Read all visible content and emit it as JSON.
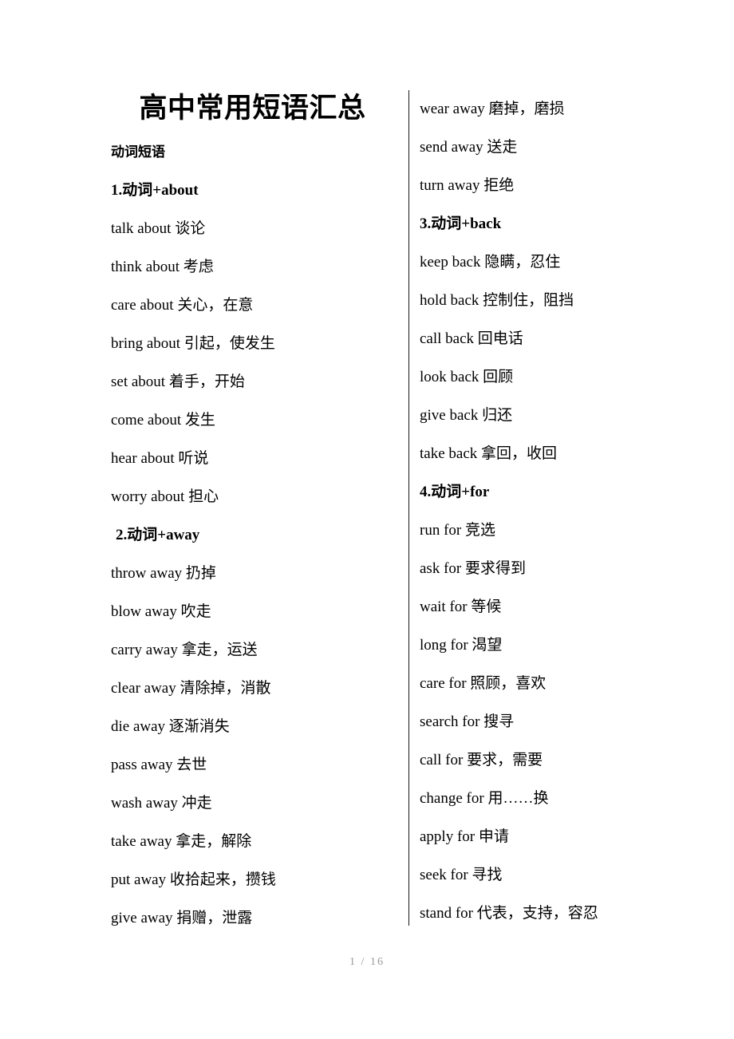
{
  "document": {
    "title": "高中常用短语汇总",
    "section_label": "动词短语",
    "footer": {
      "current_page": "1",
      "separator": "/",
      "total_pages": "16",
      "color": "#9a9a9a"
    },
    "divider_color": "#1a1a1a",
    "text_color": "#000000",
    "background_color": "#ffffff"
  },
  "columns": {
    "left": [
      {
        "type": "title",
        "text": "高中常用短语汇总"
      },
      {
        "type": "heiti",
        "text": "动词短语"
      },
      {
        "type": "subhead",
        "text": "1.动词+about"
      },
      {
        "type": "entry",
        "text": "talk about 谈论"
      },
      {
        "type": "entry",
        "text": "think about 考虑"
      },
      {
        "type": "entry",
        "text": "care about 关心，在意"
      },
      {
        "type": "entry",
        "text": "bring about 引起，使发生"
      },
      {
        "type": "entry",
        "text": "set about 着手，开始"
      },
      {
        "type": "entry",
        "text": "come about 发生"
      },
      {
        "type": "entry",
        "text": "hear about 听说"
      },
      {
        "type": "entry",
        "text": "worry about 担心"
      },
      {
        "type": "subhead",
        "text": "2.动词+away",
        "indent": true
      },
      {
        "type": "entry",
        "text": "throw away 扔掉"
      },
      {
        "type": "entry",
        "text": "blow away 吹走"
      },
      {
        "type": "entry",
        "text": "carry away 拿走，运送"
      },
      {
        "type": "entry",
        "text": "clear away 清除掉，消散"
      },
      {
        "type": "entry",
        "text": "die away 逐渐消失"
      },
      {
        "type": "entry",
        "text": "pass away 去世"
      },
      {
        "type": "entry",
        "text": "wash away 冲走"
      },
      {
        "type": "entry",
        "text": "take away 拿走，解除"
      },
      {
        "type": "entry",
        "text": "put away 收拾起来，攒钱"
      },
      {
        "type": "entry",
        "text": "give away 捐赠，泄露"
      }
    ],
    "right": [
      {
        "type": "entry",
        "text": "wear away 磨掉，磨损"
      },
      {
        "type": "entry",
        "text": "send away 送走"
      },
      {
        "type": "entry",
        "text": "turn away 拒绝"
      },
      {
        "type": "subhead",
        "text": "3.动词+back"
      },
      {
        "type": "entry",
        "text": "keep back 隐瞒，忍住"
      },
      {
        "type": "entry",
        "text": "hold back 控制住，阻挡"
      },
      {
        "type": "entry",
        "text": "call back 回电话"
      },
      {
        "type": "entry",
        "text": "look back 回顾"
      },
      {
        "type": "entry",
        "text": "give back 归还"
      },
      {
        "type": "entry",
        "text": "take back 拿回，收回"
      },
      {
        "type": "subhead",
        "text": "4.动词+for"
      },
      {
        "type": "entry",
        "text": "run for 竞选"
      },
      {
        "type": "entry",
        "text": "ask for 要求得到"
      },
      {
        "type": "entry",
        "text": "wait for 等候"
      },
      {
        "type": "entry",
        "text": "long for 渴望"
      },
      {
        "type": "entry",
        "text": "care for 照顾，喜欢"
      },
      {
        "type": "entry",
        "text": "search for 搜寻"
      },
      {
        "type": "entry",
        "text": "call for 要求，需要"
      },
      {
        "type": "entry",
        "text": "change for 用……换"
      },
      {
        "type": "entry",
        "text": "apply for 申请"
      },
      {
        "type": "entry",
        "text": "seek for 寻找"
      },
      {
        "type": "entry",
        "text": "stand for 代表，支持，容忍"
      }
    ]
  }
}
